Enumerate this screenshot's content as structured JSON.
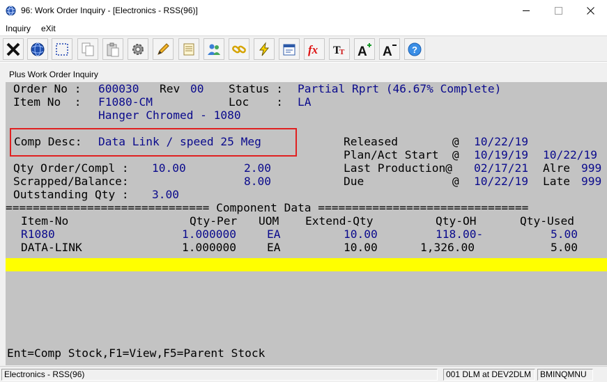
{
  "window": {
    "title": "96: Work Order Inquiry - [Electronics - RSS(96)]"
  },
  "menu": {
    "inquiry": "Inquiry",
    "exit": "eXit"
  },
  "toolbar": {
    "icons": [
      "close-x",
      "globe",
      "select-rect",
      "copy",
      "paste",
      "settings-gear",
      "edit-pencil",
      "notes",
      "users",
      "link-chain",
      "lightning",
      "calendar",
      "fx",
      "font-tt",
      "font-a-plus",
      "font-a-minus",
      "help"
    ]
  },
  "subwindow": {
    "title": "Plus Work Order Inquiry"
  },
  "header": {
    "order_label": "Order No :",
    "order_no": "600030",
    "rev_label": "Rev",
    "rev": "00",
    "status_label": "Status :",
    "status": "Partial Rprt (46.67% Complete)",
    "item_label": "Item No  :",
    "item_no": "F1080-CM",
    "loc_label": "Loc    :",
    "loc": "LA",
    "item_desc": "Hanger Chromed - 1080",
    "comp_desc_label": "Comp Desc:",
    "comp_desc": "Data Link / speed 25 Meg"
  },
  "dates": {
    "released_label": "Released        @",
    "released": "10/22/19",
    "plan_label": "Plan/Act Start  @",
    "plan_start": "10/19/19",
    "act_start": "10/22/19",
    "last_prod_label": "Last Production@",
    "last_prod": "02/17/21",
    "alre_label": "Alre",
    "alre": "999",
    "due_label": "Due             @",
    "due": "10/22/19",
    "late_label": "Late",
    "late": "999"
  },
  "quantities": {
    "qty_order_label": "Qty Order/Compl :",
    "qty_order": "10.00",
    "qty_compl": "2.00",
    "scrapped_label": "Scrapped/Balance:",
    "balance": "8.00",
    "outstanding_label": "Outstanding Qty :",
    "outstanding": "3.00"
  },
  "component_section": {
    "divider": "============================== Component Data ===============================",
    "columns": [
      "Item-No",
      "Qty-Per",
      "UOM",
      "Extend-Qty",
      "Qty-OH",
      "Qty-Used"
    ],
    "rows": [
      {
        "item": "R1080",
        "qty_per": "1.000000",
        "uom": "EA",
        "extend_qty": "10.00",
        "qty_oh": "118.00-",
        "qty_used": "5.00"
      },
      {
        "item": "DATA-LINK",
        "qty_per": "1.000000",
        "uom": "EA",
        "extend_qty": "10.00",
        "qty_oh": "1,326.00",
        "qty_used": "5.00"
      }
    ]
  },
  "footer": {
    "keys": "Ent=Comp Stock,F1=View,F5=Parent Stock"
  },
  "statusbar": {
    "company": "Electronics - RSS(96)",
    "user": "001 DLM at DEV2DLM",
    "program": "BMINQMNU"
  },
  "colors": {
    "terminal_bg": "#c3c3c3",
    "value_text": "#0a0a8c",
    "highlight": "#ffff00",
    "callout_border": "#e02020"
  }
}
